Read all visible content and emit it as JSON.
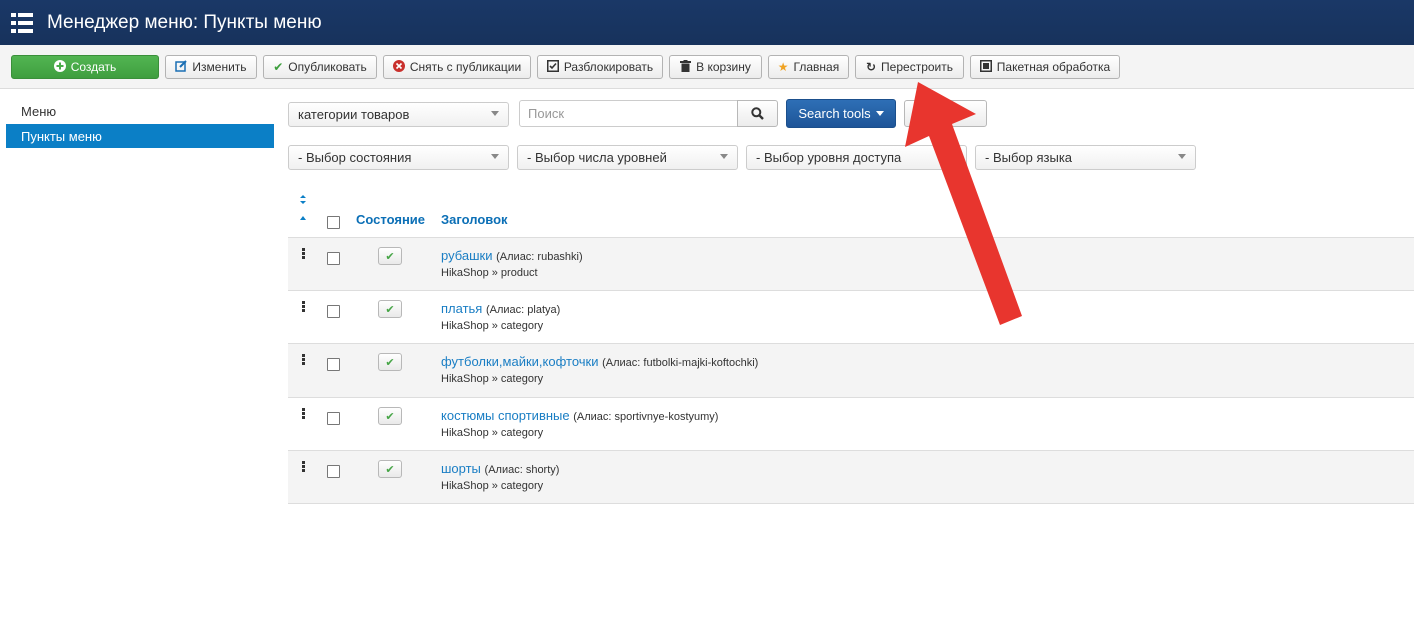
{
  "header": {
    "title": "Менеджер меню: Пункты меню",
    "icon": "list-icon"
  },
  "toolbar": {
    "buttons": [
      {
        "label": "Создать",
        "icon": "plus-circle-icon"
      },
      {
        "label": "Изменить",
        "icon": "edit-icon"
      },
      {
        "label": "Опубликовать",
        "icon": "check-icon"
      },
      {
        "label": "Снять с публикации",
        "icon": "x-circle-icon"
      },
      {
        "label": "Разблокировать",
        "icon": "checkbox-icon"
      },
      {
        "label": "В корзину",
        "icon": "trash-icon"
      },
      {
        "label": "Главная",
        "icon": "star-icon"
      },
      {
        "label": "Перестроить",
        "icon": "refresh-icon"
      },
      {
        "label": "Пакетная обработка",
        "icon": "square-icon"
      }
    ]
  },
  "sidebar": {
    "items": [
      {
        "label": "Меню",
        "active": false
      },
      {
        "label": "Пункты меню",
        "active": true
      }
    ]
  },
  "filters": {
    "menu_select": "категории товаров",
    "search_placeholder": "Поиск",
    "search_tools_label": "Search tools",
    "clear_label": "ить",
    "state_select": "- Выбор состояния",
    "levels_select": "- Выбор числа уровней",
    "access_select": "- Выбор уровня доступа",
    "language_select": "- Выбор языка"
  },
  "table": {
    "columns": {
      "state": "Состояние",
      "title": "Заголовок"
    },
    "rows": [
      {
        "title": "рубашки",
        "alias": "(Алиас: rubashki)",
        "type": "HikaShop » product",
        "published": true
      },
      {
        "title": "платья",
        "alias": "(Алиас: platya)",
        "type": "HikaShop » category",
        "published": true
      },
      {
        "title": "футболки,майки,кофточки",
        "alias": "(Алиас: futbolki-majki-koftochki)",
        "type": "HikaShop » category",
        "published": true
      },
      {
        "title": "костюмы спортивные",
        "alias": "(Алиас: sportivnye-kostyumy)",
        "type": "HikaShop » category",
        "published": true
      },
      {
        "title": "шорты",
        "alias": "(Алиас: shorty)",
        "type": "HikaShop » category",
        "published": true
      }
    ]
  },
  "colors": {
    "header": "#1a3867",
    "accent": "#0b7fc6",
    "create": "#4aad4a",
    "annotation": "#e8352e"
  }
}
